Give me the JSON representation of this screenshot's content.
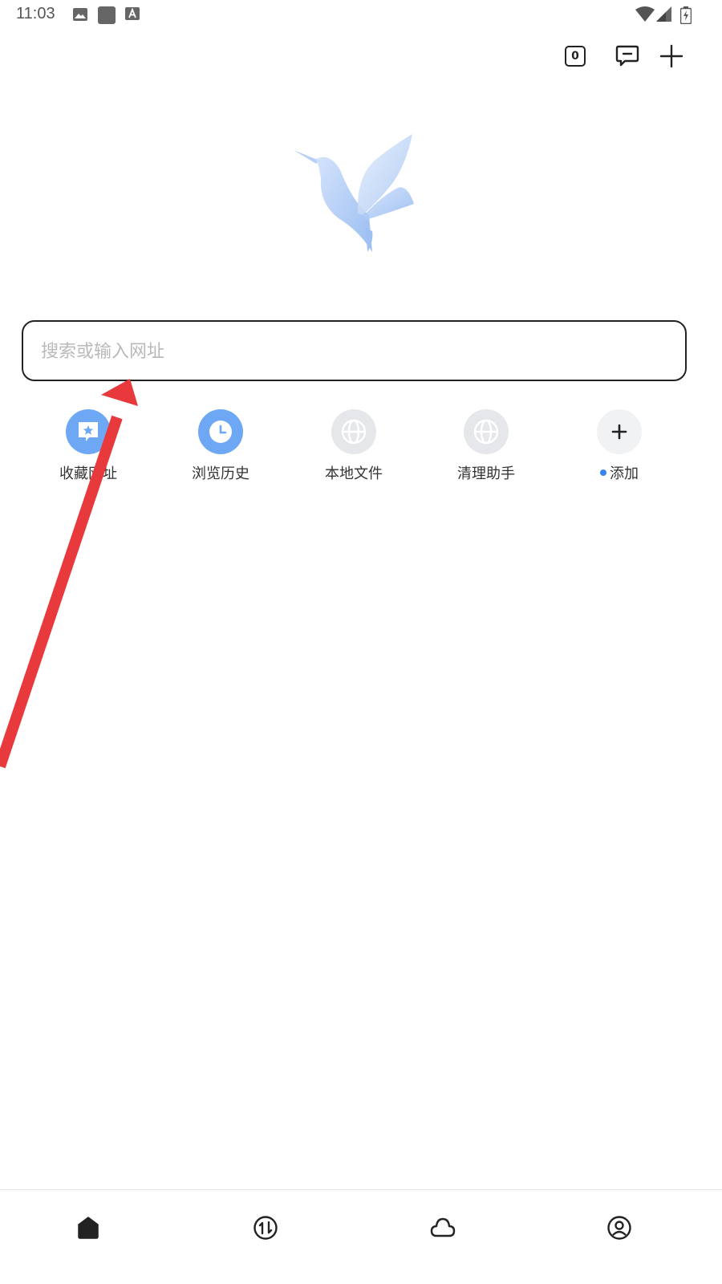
{
  "status_bar": {
    "time": "11:03",
    "icons": [
      "image-icon",
      "square-app-icon",
      "font-a-icon",
      "wifi-icon",
      "signal-icon",
      "battery-charging-icon"
    ]
  },
  "top_actions": {
    "tab_count": "0",
    "icons": [
      "tab-counter-icon",
      "message-icon",
      "plus-icon"
    ]
  },
  "logo": {
    "name": "hummingbird-logo",
    "color": "#a9c8f5"
  },
  "search": {
    "placeholder": "搜索或输入网址",
    "value": ""
  },
  "quick_links": [
    {
      "label": "收藏网址",
      "icon": "bookmark-star-icon",
      "color": "#6ea8f5"
    },
    {
      "label": "浏览历史",
      "icon": "clock-icon",
      "color": "#6ea8f5"
    },
    {
      "label": "本地文件",
      "icon": "globe-icon",
      "color": "#e6e7ea"
    },
    {
      "label": "清理助手",
      "icon": "globe-icon",
      "color": "#e6e7ea"
    },
    {
      "label": "添加",
      "icon": "plus-icon",
      "color": "#f1f2f4"
    }
  ],
  "annotation": {
    "type": "arrow",
    "color": "#e8393c"
  },
  "bottom_nav": [
    {
      "name": "home",
      "icon": "home-icon"
    },
    {
      "name": "transfer",
      "icon": "transfer-icon"
    },
    {
      "name": "cloud",
      "icon": "cloud-icon"
    },
    {
      "name": "profile",
      "icon": "profile-icon"
    }
  ]
}
